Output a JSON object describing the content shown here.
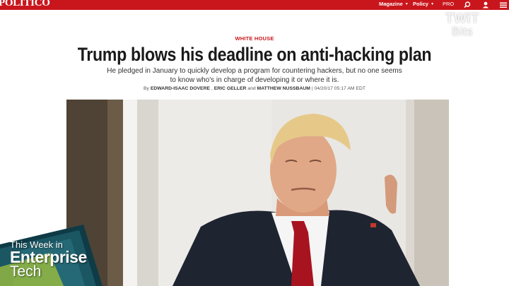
{
  "site": {
    "logo_text": "POLITICO",
    "accent_color": "#c8161c",
    "nav": {
      "magazine_label": "Magazine",
      "policy_label": "Policy",
      "pro_label": "PRO",
      "search_icon": "search-icon",
      "account_icon": "account-icon",
      "menu_icon": "menu-icon"
    }
  },
  "article": {
    "section": "WHITE HOUSE",
    "headline": "Trump blows his deadline on anti-hacking plan",
    "dek": "He pledged in January to quickly develop a program for countering hackers, but no one seems to know who's in charge of developing it or where it is.",
    "byline": {
      "by": "By",
      "author1": "EDWARD-ISAAC DOVERE",
      "sep1": ",",
      "author2": "ERIC GELLER",
      "and": "and",
      "author3": "MATTHEW NUSSBAUM",
      "timestamp": "| 04/20/17 05:17 AM EDT"
    }
  },
  "overlay": {
    "watermark_line1": "TWiT",
    "watermark_line2": "Bits",
    "show_line1": "This Week in",
    "show_line2": "Enterprise",
    "show_line3": "Tech"
  }
}
